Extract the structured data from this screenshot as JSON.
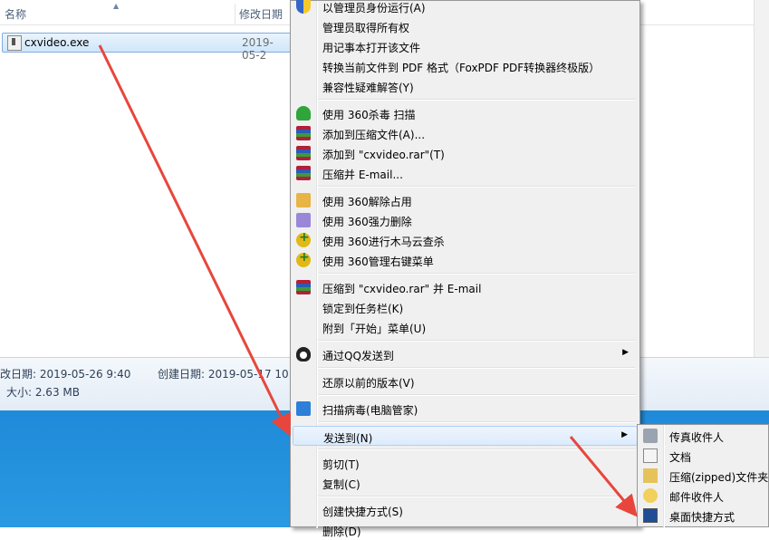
{
  "explorer": {
    "columns": {
      "name": "名称",
      "modified": "修改日期"
    },
    "file": {
      "name": "cxvideo.exe",
      "date": "2019-05-2"
    },
    "details": {
      "modified": "改日期: 2019-05-26 9:40",
      "created": "创建日期: 2019-05-17 10:",
      "size": "大小: 2.63 MB"
    }
  },
  "context_menu": {
    "items": [
      {
        "label": "以管理员身份运行(A)",
        "icon": "uac-shield-icon"
      },
      {
        "label": "管理员取得所有权",
        "icon": ""
      },
      {
        "label": "用记事本打开该文件",
        "icon": ""
      },
      {
        "label": "转换当前文件到 PDF 格式（FoxPDF PDF转换器终极版）",
        "icon": ""
      },
      {
        "label": "兼容性疑难解答(Y)",
        "icon": ""
      },
      {
        "label": "使用 360杀毒 扫描",
        "icon": "360-antivirus-icon"
      },
      {
        "label": "添加到压缩文件(A)...",
        "icon": "winrar-icon"
      },
      {
        "label": "添加到 \"cxvideo.rar\"(T)",
        "icon": "winrar-icon"
      },
      {
        "label": "压缩并 E-mail...",
        "icon": "winrar-icon"
      },
      {
        "label": "使用 360解除占用",
        "icon": "360-unlock-icon"
      },
      {
        "label": "使用 360强力删除",
        "icon": "360-delete-icon"
      },
      {
        "label": "使用 360进行木马云查杀",
        "icon": "360-plus-icon"
      },
      {
        "label": "使用 360管理右键菜单",
        "icon": "360-plus-icon"
      },
      {
        "label": "压缩到 \"cxvideo.rar\" 并 E-mail",
        "icon": "winrar-icon"
      },
      {
        "label": "锁定到任务栏(K)",
        "icon": ""
      },
      {
        "label": "附到「开始」菜单(U)",
        "icon": ""
      },
      {
        "label": "通过QQ发送到",
        "icon": "qq-icon"
      },
      {
        "label": "还原以前的版本(V)",
        "icon": ""
      },
      {
        "label": "扫描病毒(电脑管家)",
        "icon": "tencent-guard-icon"
      },
      {
        "label": "发送到(N)",
        "icon": ""
      },
      {
        "label": "剪切(T)",
        "icon": ""
      },
      {
        "label": "复制(C)",
        "icon": ""
      },
      {
        "label": "创建快捷方式(S)",
        "icon": ""
      },
      {
        "label": "删除(D)",
        "icon": ""
      }
    ]
  },
  "send_to_menu": {
    "items": [
      {
        "label": "传真收件人",
        "icon": "fax-icon"
      },
      {
        "label": "文档",
        "icon": "documents-icon"
      },
      {
        "label": "压缩(zipped)文件夹",
        "icon": "zip-folder-icon"
      },
      {
        "label": "邮件收件人",
        "icon": "mail-icon"
      },
      {
        "label": "桌面快捷方式",
        "icon": "desktop-shortcut-icon"
      }
    ]
  },
  "colors": {
    "highlight_border": "#aecff7",
    "annotation_arrow": "#e8463c",
    "desktop_blue": "#1b84d6"
  }
}
